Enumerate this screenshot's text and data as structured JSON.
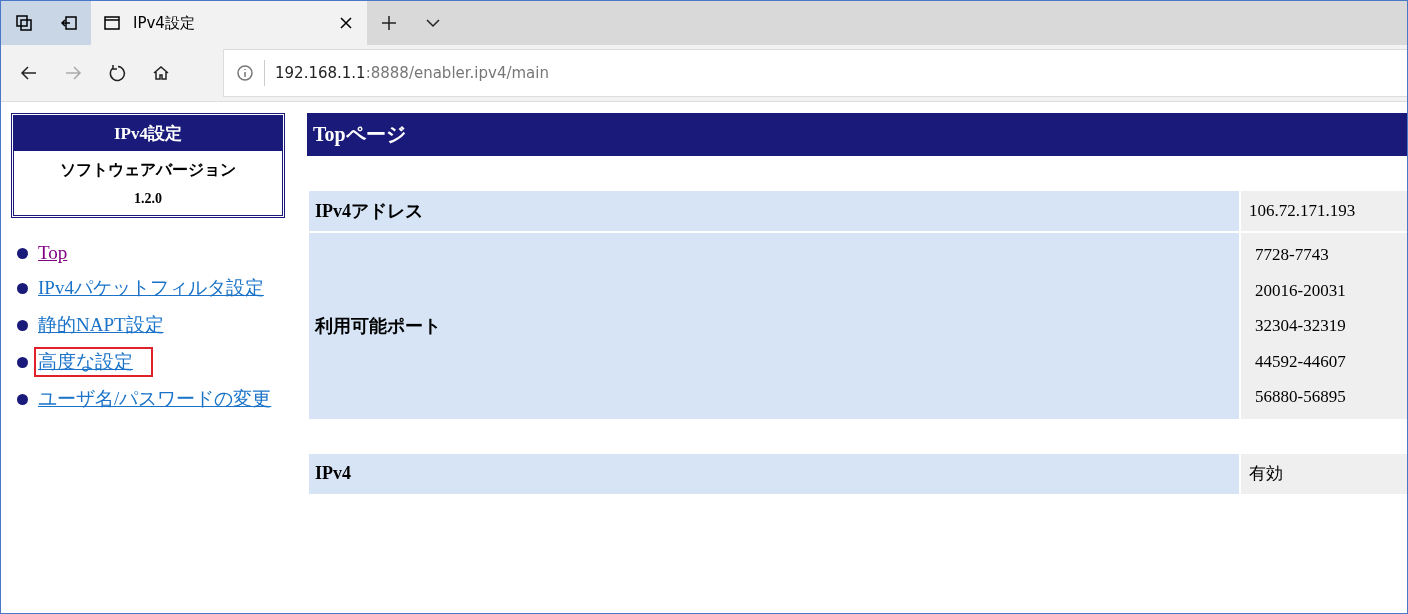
{
  "browser": {
    "tab": {
      "title": "IPv4設定",
      "selected": true
    },
    "address": {
      "host": "192.168.1.1",
      "path": ":8888/enabler.ipv4/main"
    },
    "forward_disabled": true
  },
  "sidebar": {
    "title": "IPv4設定",
    "version_label": "ソフトウェアバージョン",
    "version": "1.2.0",
    "links": [
      {
        "label": "Top",
        "visited": true,
        "highlighted": false
      },
      {
        "label": "IPv4パケットフィルタ設定",
        "visited": false,
        "highlighted": false
      },
      {
        "label": "静的NAPT設定",
        "visited": false,
        "highlighted": false
      },
      {
        "label": "高度な設定",
        "visited": false,
        "highlighted": true
      },
      {
        "label": "ユーザ名/パスワードの変更",
        "visited": false,
        "highlighted": false
      }
    ]
  },
  "page_title": "Topページ",
  "tables": [
    {
      "rows": [
        {
          "label": "IPv4アドレス",
          "values": [
            "106.72.171.193"
          ]
        },
        {
          "label": "利用可能ポート",
          "values": [
            "7728-7743",
            "20016-20031",
            "32304-32319",
            "44592-44607",
            "56880-56895"
          ]
        }
      ]
    },
    {
      "rows": [
        {
          "label": "IPv4",
          "values": [
            "有効"
          ]
        }
      ]
    }
  ]
}
